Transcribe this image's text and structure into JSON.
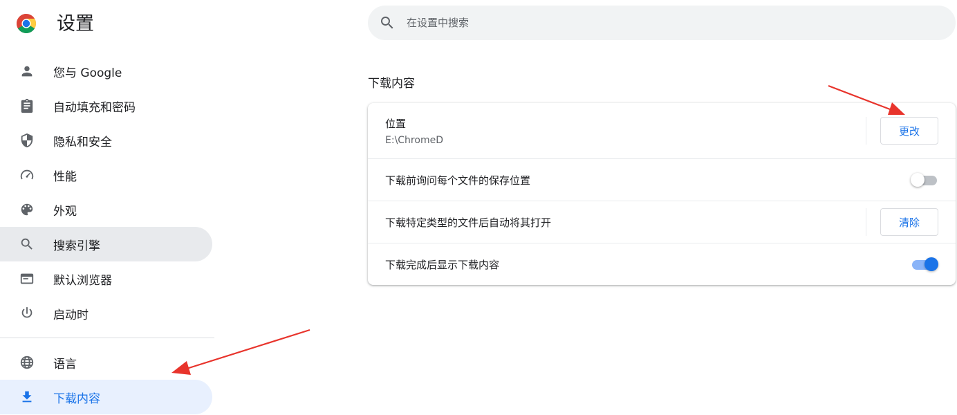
{
  "header": {
    "title": "设置",
    "logo_icon": "chrome-logo-icon"
  },
  "search": {
    "placeholder": "在设置中搜索",
    "value": "",
    "icon": "search-icon"
  },
  "sidebar": {
    "items": [
      {
        "label": "您与 Google",
        "icon": "person-icon"
      },
      {
        "label": "自动填充和密码",
        "icon": "clipboard-icon"
      },
      {
        "label": "隐私和安全",
        "icon": "shield-icon"
      },
      {
        "label": "性能",
        "icon": "speedometer-icon"
      },
      {
        "label": "外观",
        "icon": "palette-icon"
      },
      {
        "label": "搜索引擎",
        "icon": "search-icon",
        "state": "hover"
      },
      {
        "label": "默认浏览器",
        "icon": "browser-window-icon"
      },
      {
        "label": "启动时",
        "icon": "power-icon"
      },
      {
        "label": "语言",
        "icon": "globe-icon"
      },
      {
        "label": "下载内容",
        "icon": "download-icon",
        "state": "selected"
      }
    ]
  },
  "downloads": {
    "title": "下载内容",
    "location": {
      "label": "位置",
      "value": "E:\\ChromeD",
      "button": "更改"
    },
    "ask_where": {
      "label": "下载前询问每个文件的保存位置",
      "enabled": false
    },
    "auto_open": {
      "label": "下载特定类型的文件后自动将其打开",
      "button": "清除"
    },
    "show_when_done": {
      "label": "下载完成后显示下载内容",
      "enabled": true
    }
  },
  "colors": {
    "accent": "#1a73e8",
    "active_bg": "#e8f0fe",
    "hover_bg": "#e8eaed",
    "annotation_arrow": "#e8342c"
  }
}
